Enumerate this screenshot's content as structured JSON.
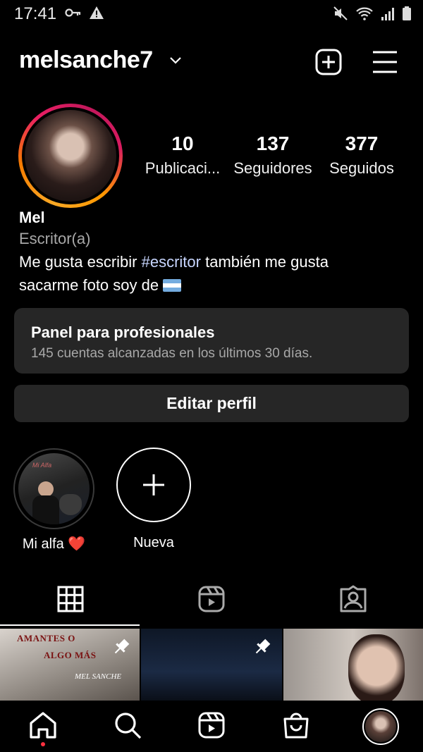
{
  "status": {
    "time": "17:41"
  },
  "header": {
    "username": "melsanche7"
  },
  "profile": {
    "stats": [
      {
        "value": "10",
        "label": "Publicaci..."
      },
      {
        "value": "137",
        "label": "Seguidores"
      },
      {
        "value": "377",
        "label": "Seguidos"
      }
    ],
    "name": "Mel",
    "category": "Escritor(a)",
    "bio_part1": "Me gusta escribir ",
    "bio_hashtag": "#escritor",
    "bio_part2": " también me gusta sacarme foto soy de "
  },
  "panel": {
    "title": "Panel para profesionales",
    "subtitle": "145 cuentas alcanzadas en los últimos 30 días."
  },
  "edit_button": "Editar perfil",
  "highlights": [
    {
      "label": "Mi alfa ❤️",
      "cover_text": "Mi Alfa"
    },
    {
      "label": "Nueva"
    }
  ],
  "grid": {
    "post1_line1": "AMANTES O",
    "post1_line2": "ALGO MÁS",
    "post1_author": "MEL SANCHE"
  },
  "colors": {
    "accent_dot": "#ff3040",
    "panel_bg": "#262626",
    "hashtag": "#c8d6ff"
  }
}
